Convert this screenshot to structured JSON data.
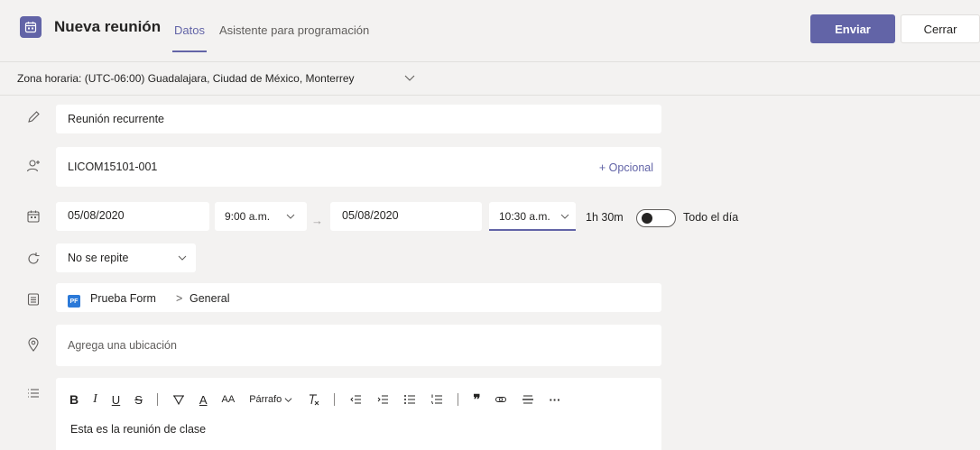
{
  "header": {
    "title": "Nueva reunión",
    "tabs": [
      {
        "label": "Datos",
        "active": true
      },
      {
        "label": "Asistente para programación",
        "active": false
      }
    ],
    "send_label": "Enviar",
    "close_label": "Cerrar",
    "accent_color": "#6264a7"
  },
  "timezone": {
    "label": "Zona horaria: (UTC-06:00) Guadalajara, Ciudad de México, Monterrey"
  },
  "form": {
    "title_value": "Reunión recurrente",
    "attendees_value": "LICOM15101-001",
    "optional_label": "+ Opcional",
    "start_date": "05/08/2020",
    "start_time": "9:00 a.m.",
    "end_date": "05/08/2020",
    "end_time": "10:30 a.m.",
    "duration": "1h 30m",
    "all_day_label": "Todo el día",
    "all_day_on": false,
    "recurrence": "No se repite",
    "channel": {
      "team": "Prueba Form",
      "separator": ">",
      "channel": "General"
    },
    "location_placeholder": "Agrega una ubicación"
  },
  "editor": {
    "toolbar": {
      "bold": "B",
      "italic": "I",
      "underline": "U",
      "strikethrough": "S",
      "font_color": "A",
      "font_size": "AA",
      "paragraph": "Párrafo",
      "more": "···"
    },
    "body_text": "Esta es la reunión de clase"
  }
}
